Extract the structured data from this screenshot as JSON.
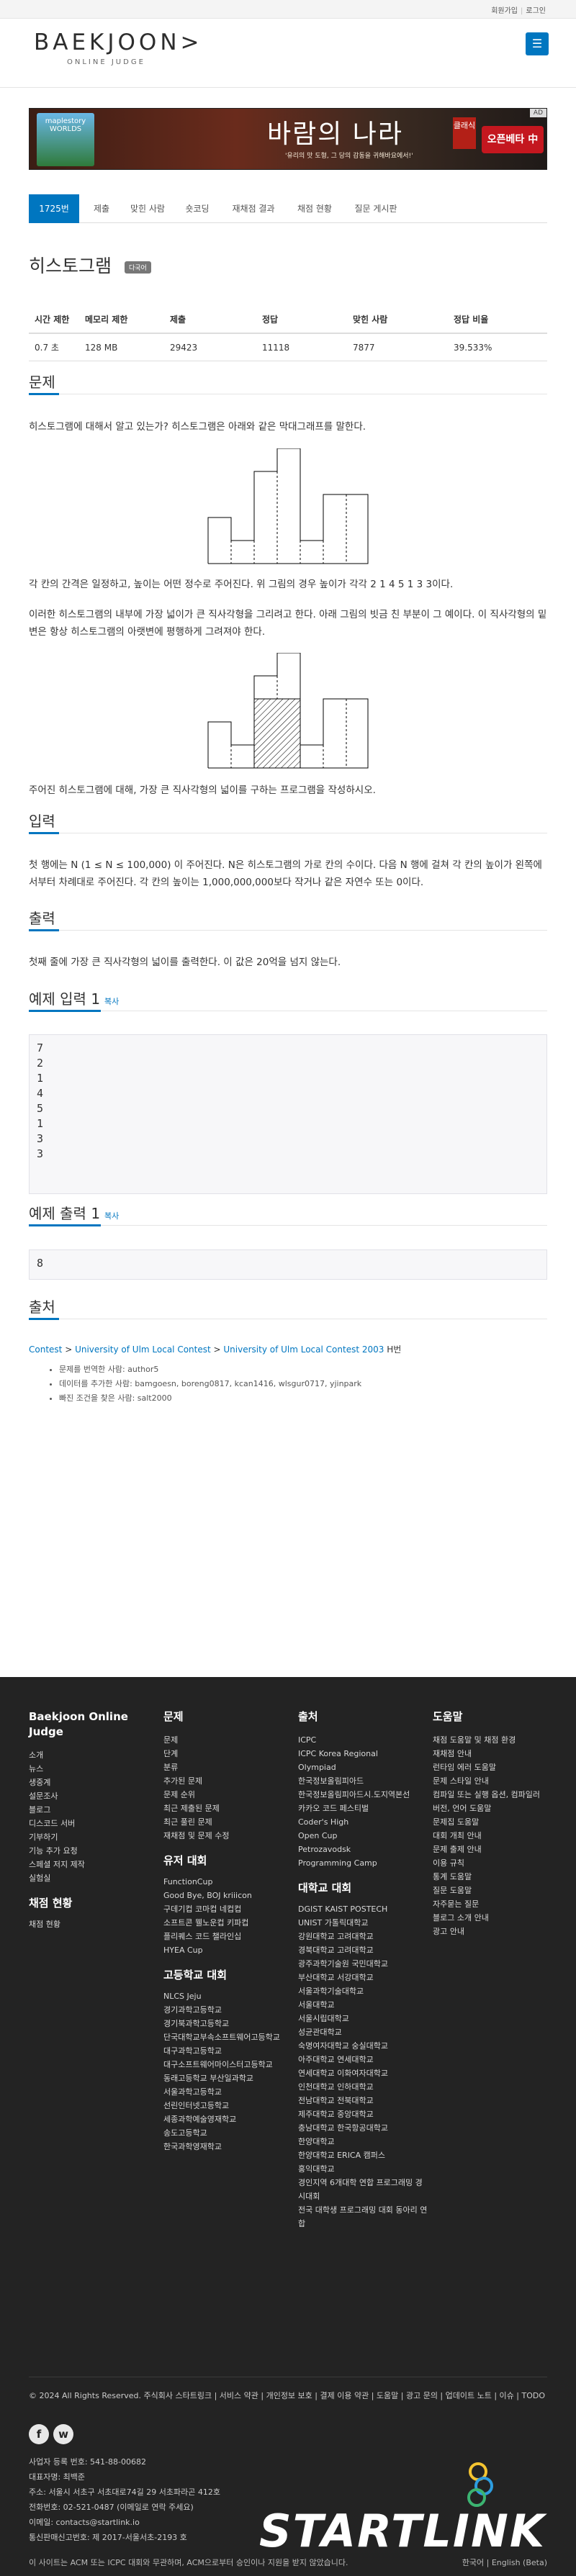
{
  "topbar": {
    "signup": "회원가입",
    "login": "로그인"
  },
  "logo": {
    "main": "BAEKJOON>",
    "sub": "ONLINE JUDGE"
  },
  "ad": {
    "left_game": "maplestory WORLDS",
    "title": "바람의 나라",
    "seal": "클래식",
    "sub": "'유리의 맛 도형, 그 당의 감동을 귀해바요에서!'",
    "cta": "오픈베타 中",
    "tag": "AD"
  },
  "tabs": [
    "1725번",
    "제출",
    "맞힌 사람",
    "숏코딩",
    "재채점 결과",
    "채점 현황",
    "질문 게시판"
  ],
  "problem": {
    "title": "히스토그램",
    "badge": "다국어"
  },
  "info": {
    "headers": [
      "시간 제한",
      "메모리 제한",
      "제출",
      "정답",
      "맞힌 사람",
      "정답 비율"
    ],
    "values": [
      "0.7 초",
      "128 MB",
      "29423",
      "11118",
      "7877",
      "39.533%"
    ]
  },
  "sections": {
    "problem": "문제",
    "input": "입력",
    "output": "출력",
    "sample_input": "예제 입력 1",
    "sample_output": "예제 출력 1",
    "source": "출처",
    "copy": "복사"
  },
  "text": {
    "p1": "히스토그램에 대해서 알고 있는가? 히스토그램은 아래와 같은 막대그래프를 말한다.",
    "p2": "각 칸의 간격은 일정하고, 높이는 어떤 정수로 주어진다. 위 그림의 경우 높이가 각각 2 1 4 5 1 3 3이다.",
    "p3": "이러한 히스토그램의 내부에 가장 넓이가 큰 직사각형을 그리려고 한다. 아래 그림의 빗금 친 부분이 그 예이다. 이 직사각형의 밑변은 항상 히스토그램의 아랫변에 평행하게 그려져야 한다.",
    "p4": "주어진 히스토그램에 대해, 가장 큰 직사각형의 넓이를 구하는 프로그램을 작성하시오.",
    "input": "첫 행에는 N (1 ≤ N ≤ 100,000) 이 주어진다. N은 히스토그램의 가로 칸의 수이다. 다음 N 행에 걸쳐 각 칸의 높이가 왼쪽에서부터 차례대로 주어진다. 각 칸의 높이는 1,000,000,000보다 작거나 같은 자연수 또는 0이다.",
    "output": "첫째 줄에 가장 큰 직사각형의 넓이를 출력한다. 이 값은 20억을 넘지 않는다."
  },
  "sample_input": "7\n2\n1\n4\n5\n1\n3\n3",
  "sample_output": "8",
  "source": {
    "link1": "Contest",
    "link2": "University of Ulm Local Contest",
    "link3": "University of Ulm Local Contest 2003",
    "suffix": "H번",
    "bullets": [
      "문제를 번역한 사람:  author5",
      "데이터를 추가한 사람:  bamgoesn, boreng0817, kcan1416, wlsgur0717, yjinpark",
      "빠진 조건을 찾은 사람:  salt2000"
    ]
  },
  "footer": {
    "col1": {
      "title": "Baekjoon Online Judge",
      "items": [
        "소개",
        "뉴스",
        "생중계",
        "설문조사",
        "블로그",
        "디스코드 서버",
        "기부하기",
        "기능 추가 요청",
        "스페셜 저지 제작",
        "실험실"
      ],
      "sub": "채점 현황",
      "sub_items": [
        "채점 현황"
      ]
    },
    "col2": {
      "title": "문제",
      "items": [
        "문제",
        "단계",
        "분류",
        "추가된 문제",
        "문제 순위",
        "최근 제출된 문제",
        "최근 풀린 문제",
        "재채점 및 문제 수정"
      ],
      "sub": "유저 대회",
      "sub_items": [
        "FunctionCup",
        "Good Bye, BOJ kriiicon",
        "구데기컵 코마컵 네컵컵",
        "소프트콘 웰노운컵 키파컵",
        "플리퀘스 코드 챌라인십",
        "HYEA Cup"
      ],
      "sub2": "고등학교 대회",
      "sub2_items": [
        "NLCS Jeju",
        "경기과학고등학교",
        "경기북과학고등학교",
        "단국대학교부속소프트웨어고등학교",
        "대구과학고등학교",
        "대구소프트웨어마이스터고등학교",
        "동래고등학교 부산일과학교",
        "서울과학고등학교",
        "선린인터넷고등학교",
        "세종과학예술영재학교",
        "송도고등학교",
        "한국과학영재학교"
      ]
    },
    "col3": {
      "title": "출처",
      "items": [
        "ICPC",
        "ICPC Korea Regional",
        "Olympiad",
        "한국정보올림피아드",
        "한국정보올림피아드시.도지역본선",
        "카카오 코드 페스티벌",
        "Coder's High",
        "Open Cup",
        "Petrozavodsk",
        "Programming Camp"
      ],
      "sub": "대학교 대회",
      "sub_items": [
        "DGIST KAIST POSTECH",
        "UNIST 가톨릭대학교",
        "강원대학교 고려대학교",
        "경북대학교 고려대학교",
        "광주과학기술원 국민대학교",
        "부산대학교 서강대학교",
        "서울과학기술대학교",
        "서울대학교",
        "서울시립대학교",
        "성균관대학교",
        "숙명여자대학교 숭실대학교",
        "아주대학교 연세대학교",
        "연세대학교 이화여자대학교",
        "인천대학교 인하대학교",
        "전남대학교 전북대학교",
        "제주대학교 중앙대학교",
        "충남대학교 한국항공대학교",
        "한양대학교",
        "한양대학교 ERICA 캠퍼스",
        "홍익대학교",
        "경인지역 6개대학 연합 프로그래밍 경시대회",
        "전국 대학생 프로그래밍 대회 동아리 연합"
      ]
    },
    "col4": {
      "title": "도움말",
      "items": [
        "채점 도움말 및 채점 환경",
        "재채점 안내",
        "런타임 에러 도움말",
        "문제 스타일 안내",
        "컴파일 또는 실행 옵션, 컴파일러 버전, 언어 도움말",
        "문제집 도움말",
        "대회 개최 안내",
        "문제 출제 안내",
        "이용 규칙",
        "통계 도움말",
        "질문 도움말",
        "자주묻는 질문",
        "블로그 소개 안내",
        "광고 안내"
      ]
    },
    "copyright": "© 2024 All Rights Reserved. 주식회사 스타트링크  |  서비스 약관  |  개인정보 보호  |  결제 이용 약관  |  도움말  |  광고 문의  |  업데이트 노트  |  이슈  |  TODO",
    "social": [
      "f",
      "w"
    ],
    "company": [
      "사업자 등록 번호: 541-88-00682",
      "대표자명: 최백준",
      "주소: 서울시 서초구 서초대로74길 29 서초파라곤 412호",
      "전화번호: 02-521-0487 (이메일로 연락 주세요)",
      "이메일: contacts@startlink.io",
      "통신판매신고번호: 제 2017-서울서초-2193 호"
    ],
    "brand": "STARTLINK",
    "notice": "이 사이트는 ACM 또는 ICPC 대회와 무관하며, ACM으로부터 승인이나 지원을 받지 않았습니다.",
    "lang": "한국어  |  English (Beta)"
  }
}
